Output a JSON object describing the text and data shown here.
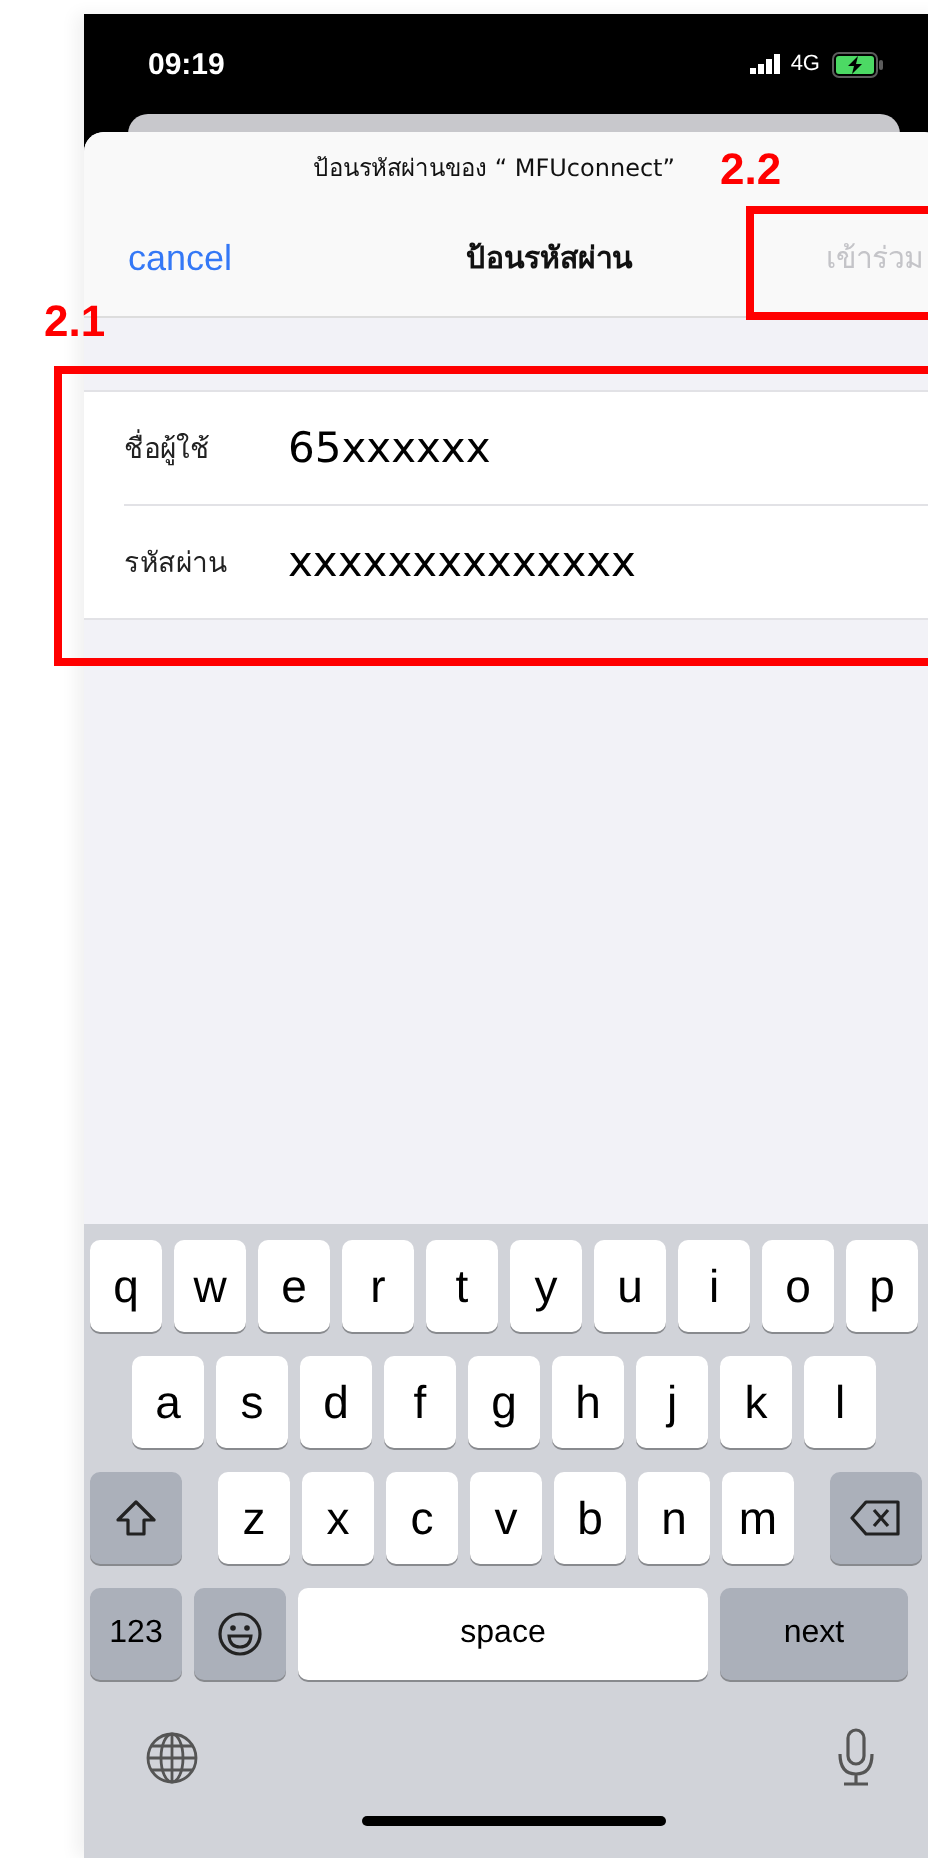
{
  "status_bar": {
    "time": "09:19",
    "network": "4G"
  },
  "dialog": {
    "subtitle": "ป้อนรหัสผ่านของ “ MFUconnect”",
    "cancel": "cancel",
    "title": "ป้อนรหัสผ่าน",
    "join": {
      "label": "เข้าร่วม",
      "disabled": true
    }
  },
  "fields": [
    {
      "label": "ชื่อผู้ใช้",
      "value": "65xxxxxx"
    },
    {
      "label": "รหัสผ่าน",
      "value": "xxxxxxxxxxxxxx"
    }
  ],
  "keyboard": {
    "row_1": [
      {
        "kind": "letter",
        "label": "q"
      },
      {
        "kind": "letter",
        "label": "w"
      },
      {
        "kind": "letter",
        "label": "e"
      },
      {
        "kind": "letter",
        "label": "r"
      },
      {
        "kind": "letter",
        "label": "t"
      },
      {
        "kind": "letter",
        "label": "y"
      },
      {
        "kind": "letter",
        "label": "u"
      },
      {
        "kind": "letter",
        "label": "i"
      },
      {
        "kind": "letter",
        "label": "o"
      },
      {
        "kind": "letter",
        "label": "p"
      }
    ],
    "row_2": [
      {
        "kind": "letter",
        "label": "a"
      },
      {
        "kind": "letter",
        "label": "s"
      },
      {
        "kind": "letter",
        "label": "d"
      },
      {
        "kind": "letter",
        "label": "f"
      },
      {
        "kind": "letter",
        "label": "g"
      },
      {
        "kind": "letter",
        "label": "h"
      },
      {
        "kind": "letter",
        "label": "j"
      },
      {
        "kind": "letter",
        "label": "k"
      },
      {
        "kind": "letter",
        "label": "l"
      }
    ],
    "row_3": [
      {
        "kind": "shift"
      },
      {
        "kind": "letter",
        "label": "z"
      },
      {
        "kind": "letter",
        "label": "x"
      },
      {
        "kind": "letter",
        "label": "c"
      },
      {
        "kind": "letter",
        "label": "v"
      },
      {
        "kind": "letter",
        "label": "b"
      },
      {
        "kind": "letter",
        "label": "n"
      },
      {
        "kind": "letter",
        "label": "m"
      },
      {
        "kind": "delete"
      }
    ],
    "row_4": [
      {
        "kind": "numbers",
        "label": "123"
      },
      {
        "kind": "emoji"
      },
      {
        "kind": "space",
        "label": "space"
      },
      {
        "kind": "return",
        "label": "next"
      }
    ]
  },
  "annotations": [
    {
      "label": "2.1",
      "kind": "form-frame"
    },
    {
      "label": "2.2",
      "kind": "button-frame"
    }
  ]
}
